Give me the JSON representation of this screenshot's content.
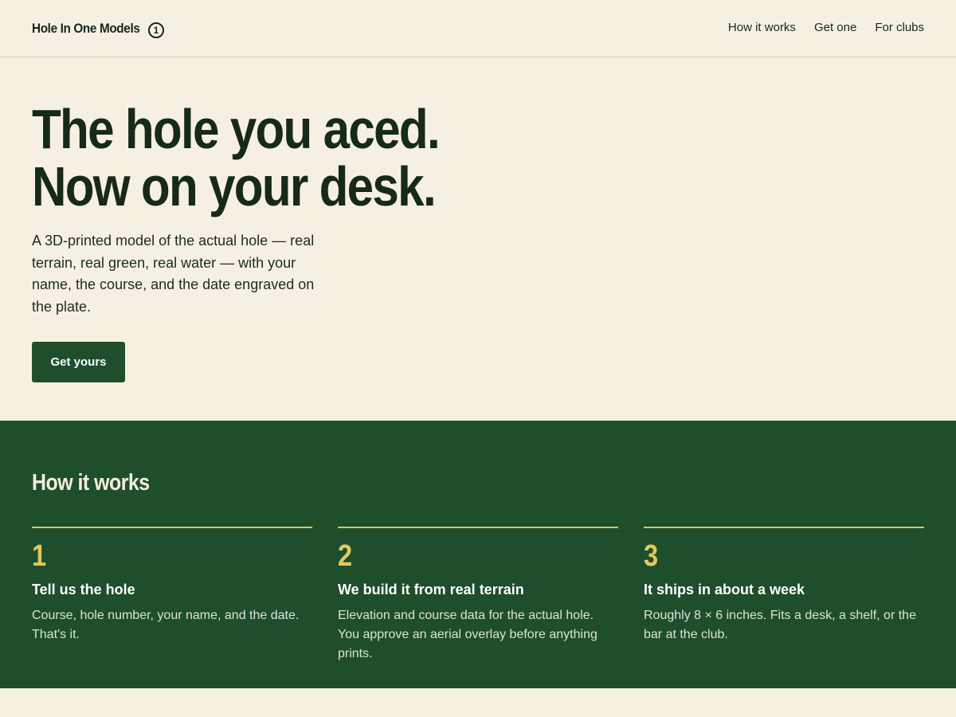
{
  "header": {
    "brand": "Hole In One Models",
    "badge": "1",
    "nav": [
      {
        "label": "How it works"
      },
      {
        "label": "Get one"
      },
      {
        "label": "For clubs"
      }
    ]
  },
  "hero": {
    "title_line1": "The hole you aced.",
    "title_line2": "Now on your desk.",
    "description": "A 3D-printed model of the actual hole — real terrain, real green, real water — with your name, the course, and the date engraved on the plate.",
    "cta_label": "Get yours"
  },
  "how_it_works": {
    "title": "How it works",
    "steps": [
      {
        "number": "1",
        "title": "Tell us the hole",
        "description": "Course, hole number, your name, and the date. That's it."
      },
      {
        "number": "2",
        "title": "We build it from real terrain",
        "description": "Elevation and course data for the actual hole. You approve an aerial overlay before anything prints."
      },
      {
        "number": "3",
        "title": "It ships in about a week",
        "description": "Roughly 8 × 6 inches. Fits a desk, a shelf, or the bar at the club."
      }
    ]
  },
  "colors": {
    "background": "#f6f0e3",
    "brand_green": "#1e4e2c",
    "text_dark": "#15291b",
    "accent_gold": "#d9c45e"
  }
}
